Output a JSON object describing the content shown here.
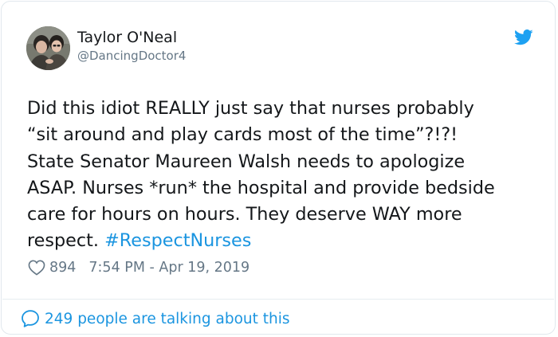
{
  "author": {
    "display_name": "Taylor O'Neal",
    "handle": "@DancingDoctor4",
    "avatar_icon": "profile-photo"
  },
  "brand": {
    "icon": "twitter-bird-icon",
    "color": "#1da1f2"
  },
  "tweet": {
    "lines": [
      "Did this idiot REALLY just say that nurses probably",
      "“sit around and play cards most of the time”?!?!",
      "State Senator Maureen Walsh needs to apologize",
      "ASAP. Nurses *run* the hospital and provide bedside",
      "care for hours on hours. They deserve WAY more",
      "respect."
    ],
    "hashtag": "#RespectNurses",
    "hashtag_color": "#1b95e0"
  },
  "meta": {
    "like_icon": "heart-icon",
    "like_count": "894",
    "timestamp": "7:54 PM - Apr 19, 2019"
  },
  "footer": {
    "icon": "speech-bubble-icon",
    "talking_text": "249 people are talking about this"
  }
}
